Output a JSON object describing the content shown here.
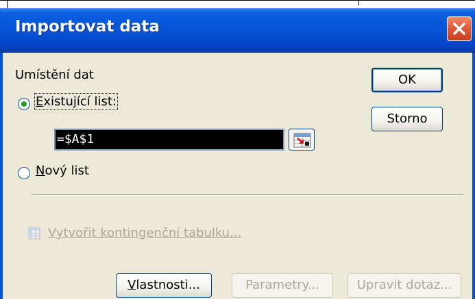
{
  "window": {
    "title": "Importovat data"
  },
  "placement": {
    "section_label": "Umístění dat",
    "existing_sheet_label": "Existující list:",
    "existing_sheet_mnemonic": "E",
    "existing_sheet_rest": "xistující list:",
    "existing_sheet_selected": true,
    "reference_value": "=$A$1",
    "new_sheet_label": "Nový list",
    "new_sheet_mnemonic": "N",
    "new_sheet_rest": "ový list",
    "new_sheet_selected": false
  },
  "pivot": {
    "label": "Vytvořit kontingenční tabulku...",
    "enabled": false
  },
  "buttons": {
    "ok": "OK",
    "cancel": "Storno",
    "properties": "Vlastnosti...",
    "properties_mnemonic": "V",
    "properties_rest": "lastnosti...",
    "parameters": "Parametry...",
    "edit_query": "Upravit dotaz..."
  },
  "colors": {
    "titlebar": "#0655d8",
    "dialog_bg": "#ece9d8",
    "close_button": "#e05a3a",
    "radio_dot": "#21a121",
    "disabled_text": "#aca899"
  },
  "icons": {
    "close": "close-icon",
    "range_selector": "collapse-dialog-icon",
    "pivot": "pivot-table-icon"
  }
}
